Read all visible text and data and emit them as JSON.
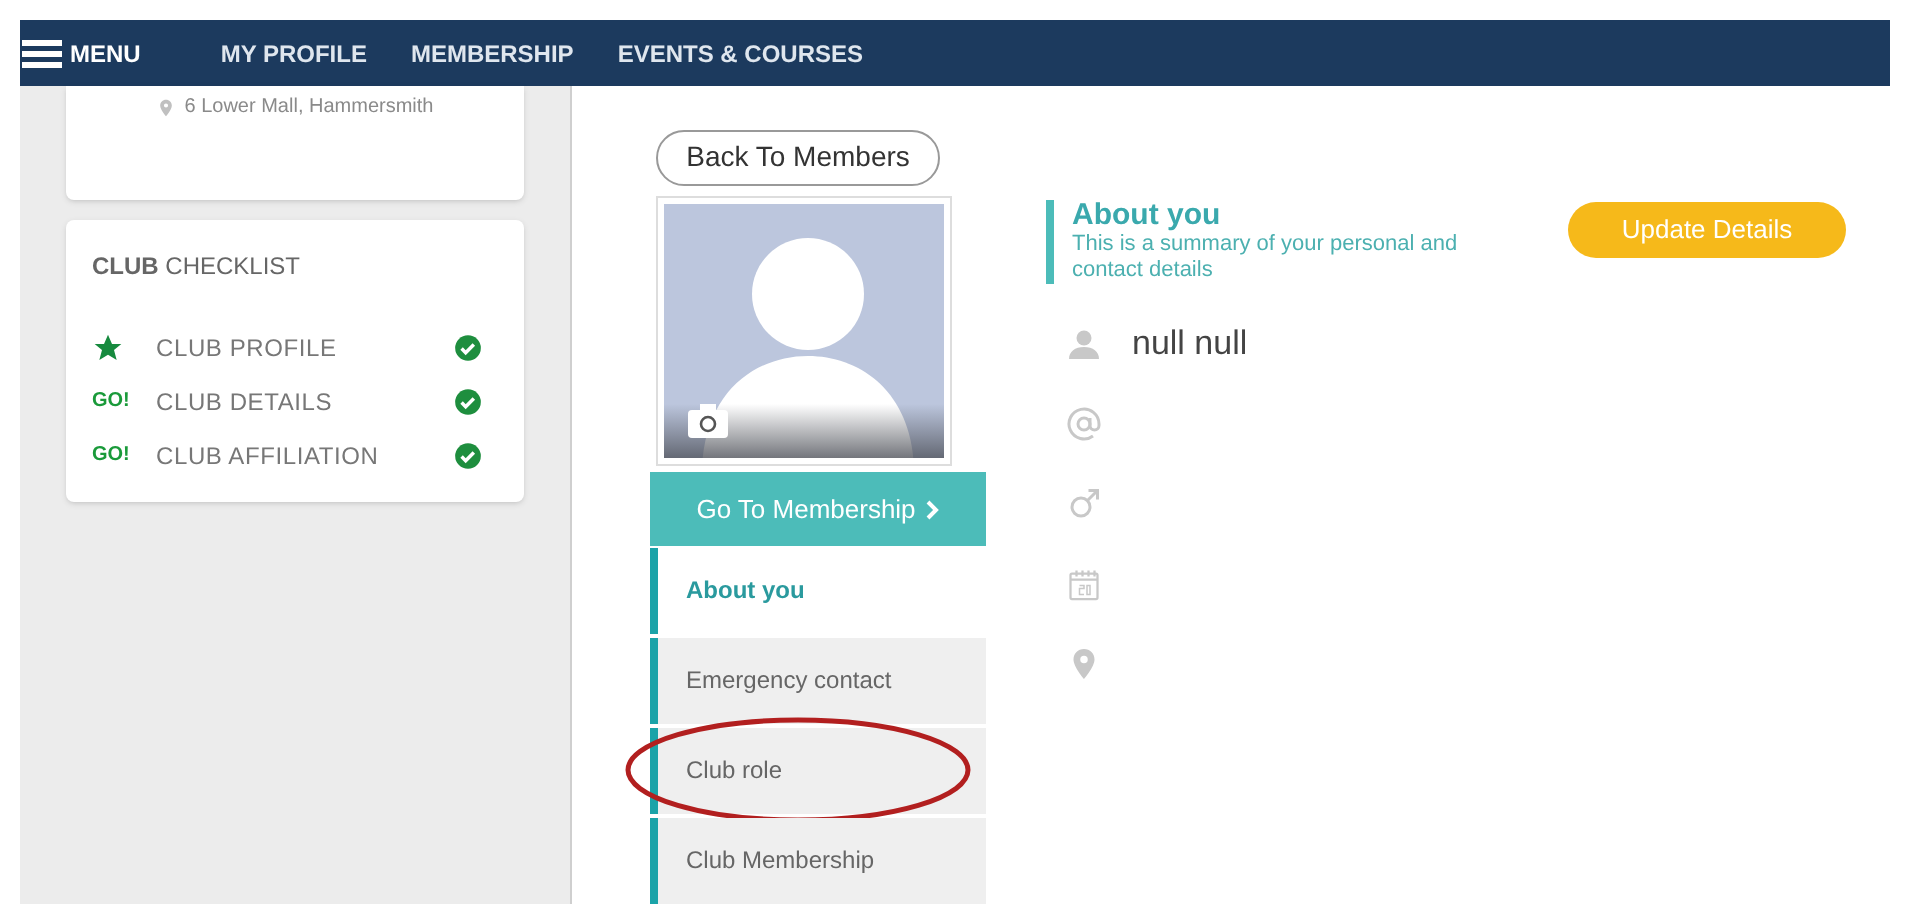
{
  "nav": {
    "menu_label": "MENU",
    "items": [
      "MY PROFILE",
      "MEMBERSHIP",
      "EVENTS & COURSES"
    ]
  },
  "club_card": {
    "address": "6 Lower Mall, Hammersmith"
  },
  "checklist": {
    "title": "**CLUB** CHECKLIST",
    "items": [
      {
        "kind": "star",
        "label": "CLUB PROFILE",
        "checked": true
      },
      {
        "kind": "go",
        "badge": "GO!",
        "label": "CLUB DETAILS",
        "checked": true
      },
      {
        "kind": "go",
        "badge": "GO!",
        "label": "CLUB AFFILIATION",
        "checked": true
      }
    ]
  },
  "back_button": "Back To Members",
  "membership_button": "Go To Membership",
  "sections": [
    {
      "label": "About you",
      "selected": true
    },
    {
      "label": "Emergency contact",
      "selected": false
    },
    {
      "label": "Club role",
      "selected": false,
      "circled": true
    },
    {
      "label": "Club Membership",
      "selected": false
    }
  ],
  "header": {
    "title": "About you",
    "subtitle": "This is a summary of your personal and contact details",
    "button": "Update Details"
  },
  "fields": [
    {
      "kind": "name",
      "value": "null null"
    },
    {
      "kind": "email"
    },
    {
      "kind": "gender"
    },
    {
      "kind": "birthday"
    },
    {
      "kind": "location"
    }
  ]
}
